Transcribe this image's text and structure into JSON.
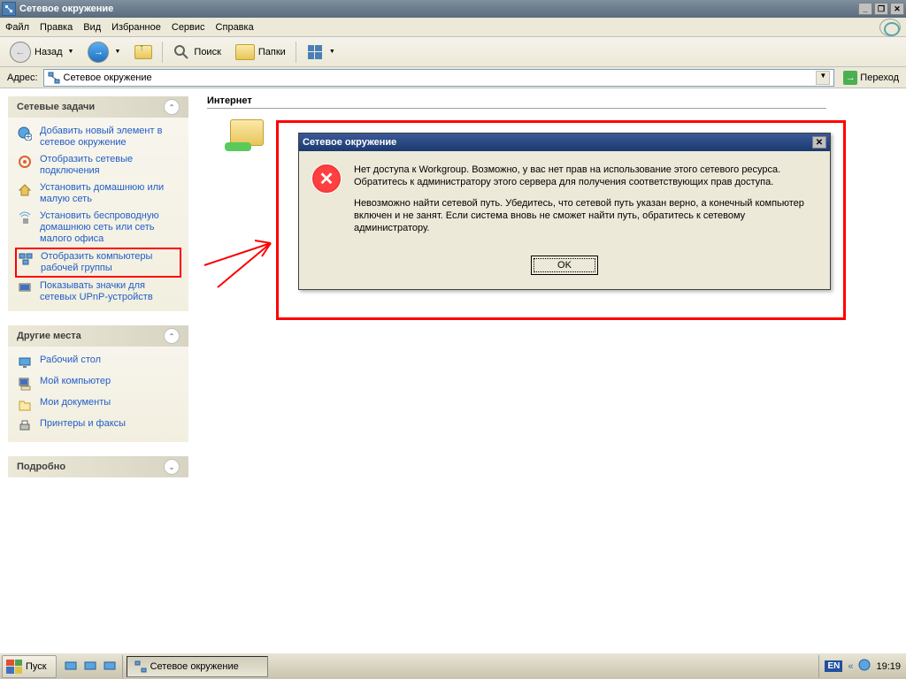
{
  "window": {
    "title": "Сетевое окружение"
  },
  "menu": {
    "file": "Файл",
    "edit": "Правка",
    "view": "Вид",
    "favorites": "Избранное",
    "tools": "Сервис",
    "help": "Справка"
  },
  "toolbar": {
    "back": "Назад",
    "search": "Поиск",
    "folders": "Папки"
  },
  "address": {
    "label": "Адрес:",
    "value": "Сетевое окружение",
    "go": "Переход"
  },
  "sidebar": {
    "tasks_title": "Сетевые задачи",
    "tasks": [
      "Добавить новый элемент в сетевое окружение",
      "Отобразить сетевые подключения",
      "Установить домашнюю или малую сеть",
      "Установить беспроводную домашнюю сеть или сеть малого офиса",
      "Отобразить компьютеры рабочей группы",
      "Показывать значки для сетевых UPnP-устройств"
    ],
    "places_title": "Другие места",
    "places": [
      "Рабочий стол",
      "Мой компьютер",
      "Мои документы",
      "Принтеры и факсы"
    ],
    "details_title": "Подробно"
  },
  "main": {
    "group": "Интернет"
  },
  "dialog": {
    "title": "Сетевое окружение",
    "para1": "Нет доступа к Workgroup. Возможно, у вас нет прав на использование этого сетевого ресурса. Обратитесь к администратору этого сервера для получения соответствующих прав доступа.",
    "para2": "Невозможно найти сетевой путь. Убедитесь, что сетевой путь указан верно, а конечный компьютер включен и не занят. Если система вновь не сможет найти путь, обратитесь к сетевому администратору.",
    "ok": "OK"
  },
  "taskbar": {
    "start": "Пуск",
    "task": "Сетевое окружение",
    "lang": "EN",
    "time": "19:19"
  }
}
